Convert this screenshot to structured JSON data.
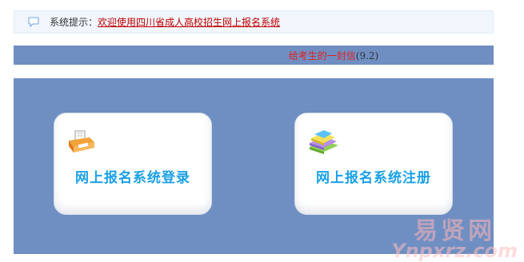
{
  "notice": {
    "prefix": "系统提示：",
    "message": "欢迎使用四川省成人高校招生网上报名系统"
  },
  "letter": {
    "link_text": "给考生的一封信",
    "version": "(9.2)"
  },
  "cards": {
    "login_label": "网上报名系统登录",
    "register_label": "网上报名系统注册"
  },
  "watermark": {
    "logo_text": "易贤网",
    "url_text": "Ynpxrz.com"
  },
  "colors": {
    "panel": "#6f8fc3",
    "accent_text": "#1aa0e6",
    "link_red": "#c00000"
  }
}
